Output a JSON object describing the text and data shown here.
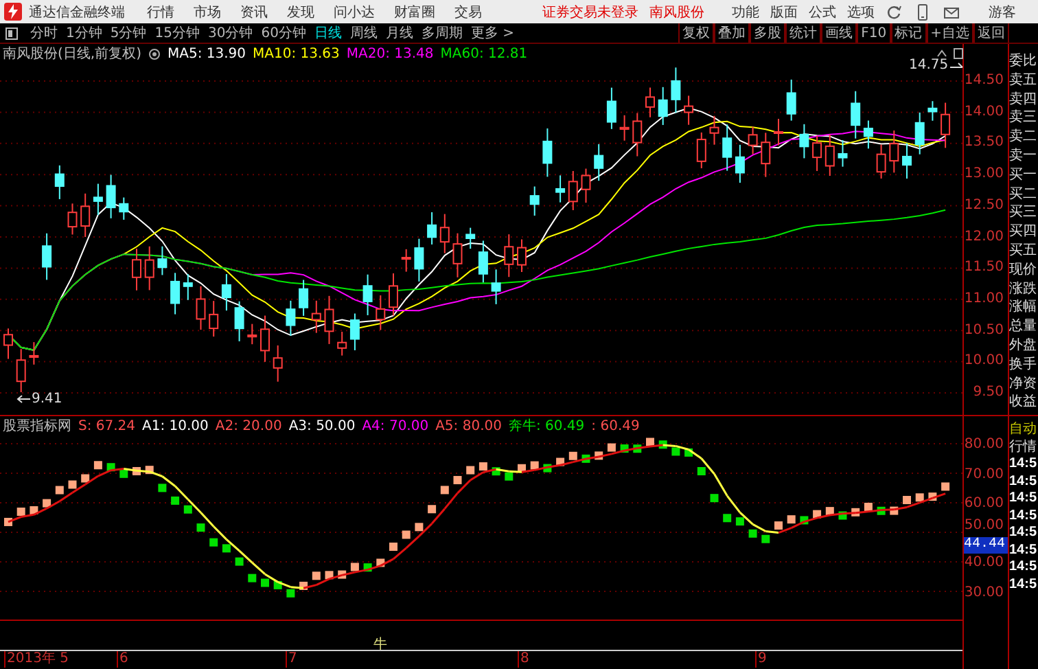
{
  "menu_bar": {
    "app_title": "通达信金融终端",
    "menus": [
      "行情",
      "市场",
      "资讯",
      "发现",
      "问小达",
      "财富圈",
      "交易"
    ],
    "login_status": "证券交易未登录",
    "stock_name": "南风股份",
    "right_menus": [
      "功能",
      "版面",
      "公式",
      "选项"
    ],
    "user": "游客"
  },
  "period_tabs": [
    {
      "label": "分时",
      "selected": false
    },
    {
      "label": "1分钟",
      "selected": false
    },
    {
      "label": "5分钟",
      "selected": false
    },
    {
      "label": "15分钟",
      "selected": false
    },
    {
      "label": "30分钟",
      "selected": false
    },
    {
      "label": "60分钟",
      "selected": false
    },
    {
      "label": "日线",
      "selected": true
    },
    {
      "label": "周线",
      "selected": false
    },
    {
      "label": "月线",
      "selected": false
    },
    {
      "label": "多周期",
      "selected": false
    },
    {
      "label": "更多 >",
      "selected": false
    }
  ],
  "toolbar_buttons": [
    "复权",
    "叠加",
    "多股",
    "统计",
    "画线",
    "F10",
    "标记",
    "+自选",
    "返回"
  ],
  "main_chart": {
    "title": "南风股份(日线,前复权)",
    "ma_legend": [
      {
        "label": "MA5: 13.90",
        "color": "#ffffff"
      },
      {
        "label": "MA10: 13.63",
        "color": "#ffff00"
      },
      {
        "label": "MA20: 13.48",
        "color": "#ff00ff"
      },
      {
        "label": "MA60: 12.81",
        "color": "#00e600"
      }
    ],
    "high_marker": "14.75",
    "low_marker": "9.41",
    "price_ticks": [
      "14.50",
      "14.00",
      "13.50",
      "13.00",
      "12.50",
      "12.00",
      "11.50",
      "11.00",
      "10.50",
      "10.00",
      "9.50"
    ]
  },
  "indicator": {
    "title": "股票指标网",
    "legend": [
      {
        "label": "S: 67.24",
        "color": "#ff5050"
      },
      {
        "label": "A1: 10.00",
        "color": "#ffffff"
      },
      {
        "label": "A2: 20.00",
        "color": "#ff5050"
      },
      {
        "label": "A3: 50.00",
        "color": "#ffffff"
      },
      {
        "label": "A4: 70.00",
        "color": "#ff00ff"
      },
      {
        "label": "A5: 80.00",
        "color": "#ff5050"
      },
      {
        "label": "奔牛: 60.49",
        "color": "#00e600"
      },
      {
        "label": ": 60.49",
        "color": "#ff5050"
      }
    ],
    "ticks": [
      "80.00",
      "70.00",
      "60.00",
      "50.00",
      "40.00",
      "30.00"
    ],
    "current_value": "44.44",
    "signal_marker": "牛"
  },
  "date_axis": {
    "labels": [
      "2013年 5",
      "6",
      "7",
      "8",
      "9"
    ]
  },
  "quote_panel": {
    "field_labels": [
      "委比",
      "卖五",
      "卖四",
      "卖三",
      "卖二",
      "卖一",
      "买一",
      "买二",
      "买三",
      "买四",
      "买五",
      "现价",
      "涨跌",
      "涨幅",
      "总量",
      "外盘",
      "换手",
      "净资",
      "收益"
    ],
    "auto_label": "自动",
    "quote_label": "行情",
    "tick_times": [
      "14:5",
      "14:5",
      "14:5",
      "14:5",
      "14:5",
      "14:5",
      "14:5",
      "14:5"
    ]
  }
}
